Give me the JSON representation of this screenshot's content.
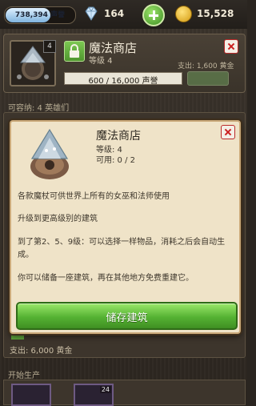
{
  "topbar": {
    "reputation": "738,394 声誉",
    "gems": "164",
    "gold": "15,528"
  },
  "building": {
    "badge": "4",
    "name": "魔法商店",
    "level": "等级 4",
    "cost": "支出: 1,600 黄金",
    "progress_text": "600 / 16,000 声誉",
    "progress_fraction": 0.0375
  },
  "capacity_label": "可容纳: 4 英雄们",
  "bottom": {
    "cost": "支出: 6,000 黄金",
    "section": "开始生产",
    "thumb_badge": "24"
  },
  "modal": {
    "title": "魔法商店",
    "level": "等级: 4",
    "available": "可用: 0 / 2",
    "desc1": "各款魔杖可供世界上所有的女巫和法师使用",
    "desc2": "升级到更高级别的建筑",
    "desc3": "到了第2、5、9级：可以选择一样物品，消耗之后会自动生成。",
    "desc4": "你可以储备一座建筑，再在其他地方免费重建它。",
    "store_button": "储存建筑"
  },
  "colors": {
    "accent_green": "#55b233",
    "close_red": "#cc2020",
    "modal_bg": "#efe3c8"
  }
}
